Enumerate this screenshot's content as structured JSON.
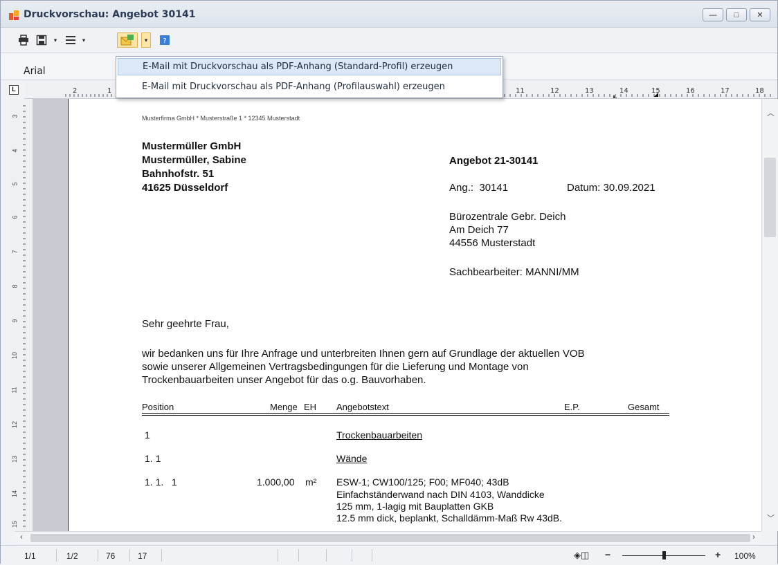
{
  "window": {
    "title": "Druckvorschau: Angebot 30141",
    "minimize": "—",
    "maximize": "□",
    "close": "✕"
  },
  "toolbar": {
    "font_name": "Arial",
    "icons": [
      "print-icon",
      "save-icon",
      "menu-lines-icon",
      "email-pdf-icon",
      "help-icon"
    ]
  },
  "menu": {
    "items": [
      "E-Mail mit Druckvorschau als PDF-Anhang (Standard-Profil) erzeugen",
      "E-Mail mit Druckvorschau als PDF-Anhang (Profilauswahl) erzeugen"
    ]
  },
  "ruler": {
    "h_labels": [
      "2",
      "1",
      "11",
      "12",
      "13",
      "14",
      "15",
      "16",
      "17",
      "18"
    ],
    "v_labels": [
      "3",
      "4",
      "5",
      "6",
      "7",
      "8",
      "9",
      "10",
      "11",
      "12",
      "13",
      "14",
      "15"
    ]
  },
  "document": {
    "sender_line": "Musterfirma GmbH * Musterstraße 1 * 12345 Musterstadt",
    "recipient": [
      "Mustermüller GmbH",
      "Mustermüller, Sabine",
      "Bahnhofstr. 51",
      "41625 Düsseldorf"
    ],
    "offer_title": "Angebot 21-30141",
    "ang_label": "Ang.:  30141",
    "date_label": "Datum: 30.09.2021",
    "company": [
      "Bürozentrale Gebr. Deich",
      "Am Deich 77",
      "44556 Musterstadt"
    ],
    "clerk": "Sachbearbeiter: MANNI/MM",
    "salutation": "Sehr geehrte Frau,",
    "body": [
      "wir bedanken uns für Ihre Anfrage und unterbreiten Ihnen gern auf Grundlage der aktuellen VOB",
      "sowie unserer Allgemeinen Vertragsbedingungen für die Lieferung und Montage von",
      "Trockenbauarbeiten unser Angebot für das o.g. Bauvorhaben."
    ],
    "table_headers": {
      "position": "Position",
      "menge": "Menge",
      "eh": "EH",
      "text": "Angebotstext",
      "ep": "E.P.",
      "gesamt": "Gesamt"
    },
    "rows": [
      {
        "pos": "1",
        "text": "Trockenbauarbeiten"
      },
      {
        "pos": "1. 1",
        "text": "Wände"
      },
      {
        "pos": "1. 1.   1",
        "menge": "1.000,00",
        "eh": "m²",
        "text": "ESW-1; CW100/125; F00; MF040; 43dB"
      }
    ],
    "detail_lines": [
      "Einfachständerwand nach DIN 4103, Wanddicke",
      "125 mm, 1-lagig mit Bauplatten GKB",
      "12.5 mm dick, beplankt, Schalldämm-Maß Rw 43dB."
    ]
  },
  "status": {
    "page": "1/1",
    "pages": "1/2",
    "val1": "76",
    "val2": "17",
    "zoom": "100%",
    "zoom_minus": "−",
    "zoom_plus": "+"
  }
}
